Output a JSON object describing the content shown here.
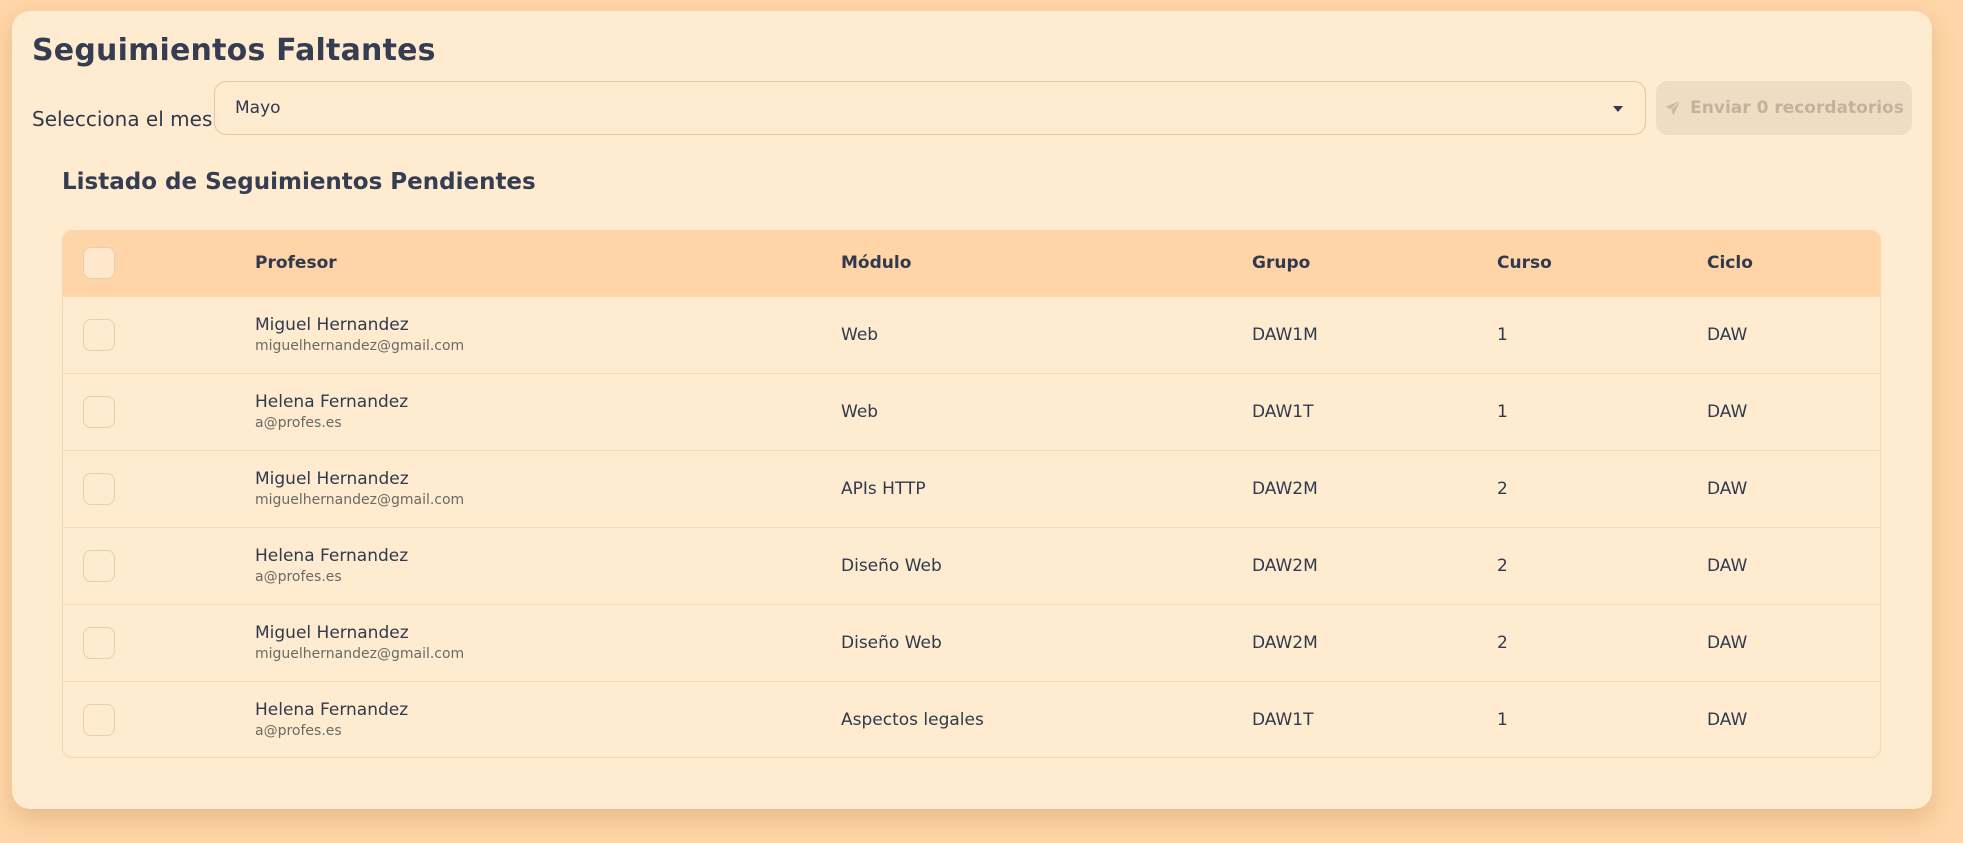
{
  "header": {
    "title": "Seguimientos Faltantes",
    "month_label": "Selecciona el mes:",
    "month_selected": "Mayo",
    "send_button_label": "Enviar 0 recordatorios"
  },
  "list": {
    "title": "Listado de Seguimientos Pendientes",
    "columns": {
      "profesor": "Profesor",
      "modulo": "Módulo",
      "grupo": "Grupo",
      "curso": "Curso",
      "ciclo": "Ciclo"
    },
    "rows": [
      {
        "name": "Miguel Hernandez",
        "email": "miguelhernandez@gmail.com",
        "modulo": "Web",
        "grupo": "DAW1M",
        "curso": "1",
        "ciclo": "DAW"
      },
      {
        "name": "Helena Fernandez",
        "email": "a@profes.es",
        "modulo": "Web",
        "grupo": "DAW1T",
        "curso": "1",
        "ciclo": "DAW"
      },
      {
        "name": "Miguel Hernandez",
        "email": "miguelhernandez@gmail.com",
        "modulo": "APIs HTTP",
        "grupo": "DAW2M",
        "curso": "2",
        "ciclo": "DAW"
      },
      {
        "name": "Helena Fernandez",
        "email": "a@profes.es",
        "modulo": "Diseño Web",
        "grupo": "DAW2M",
        "curso": "2",
        "ciclo": "DAW"
      },
      {
        "name": "Miguel Hernandez",
        "email": "miguelhernandez@gmail.com",
        "modulo": "Diseño Web",
        "grupo": "DAW2M",
        "curso": "2",
        "ciclo": "DAW"
      },
      {
        "name": "Helena Fernandez",
        "email": "a@profes.es",
        "modulo": "Aspectos legales",
        "grupo": "DAW1T",
        "curso": "1",
        "ciclo": "DAW"
      }
    ]
  },
  "colors": {
    "background": "#ffd6a8",
    "card": "#ffebcf",
    "table_header": "#ffd4a6",
    "text": "#2f3a4f",
    "disabled_button": "#f0dcc2"
  },
  "icons": {
    "send": "paper-plane-icon",
    "dropdown": "chevron-down-icon"
  }
}
